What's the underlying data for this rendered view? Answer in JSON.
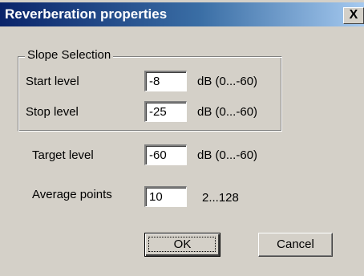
{
  "window": {
    "title": "Reverberation properties",
    "close_glyph": "X"
  },
  "slope_group": {
    "legend": "Slope Selection",
    "start_label": "Start level",
    "start_value": "-8",
    "start_unit": "dB (0...-60)",
    "stop_label": "Stop level",
    "stop_value": "-25",
    "stop_unit": "dB (0...-60)"
  },
  "target": {
    "label": "Target level",
    "value": "-60",
    "unit": "dB (0...-60)"
  },
  "average": {
    "label": "Average points",
    "value": "10",
    "range": "2...128"
  },
  "buttons": {
    "ok": "OK",
    "cancel": "Cancel"
  }
}
